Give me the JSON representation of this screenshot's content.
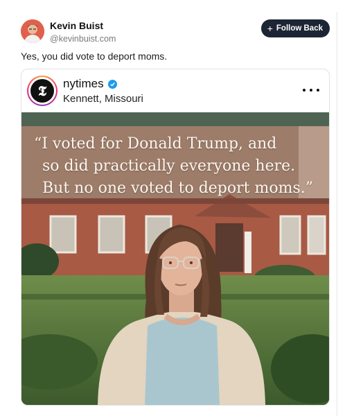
{
  "post": {
    "author_name": "Kevin Buist",
    "author_handle": "@kevinbuist.com",
    "follow_label": "Follow Back",
    "text": "Yes, you did vote to deport moms."
  },
  "embed": {
    "account": "nytimes",
    "location": "Kennett, Missouri",
    "quote_lines": [
      "“I voted for Donald Trump, and",
      "so did practically everyone here.",
      "But no one voted to deport moms.”"
    ]
  },
  "colors": {
    "follow_button": "#1c2533",
    "verified": "#1d9bf0",
    "quote_text": "#fbf6ee"
  },
  "icons": {
    "follow": "plus-icon",
    "verified": "verified-check-icon",
    "menu": "more-dots-icon",
    "logo": "nytimes-t-logo"
  }
}
